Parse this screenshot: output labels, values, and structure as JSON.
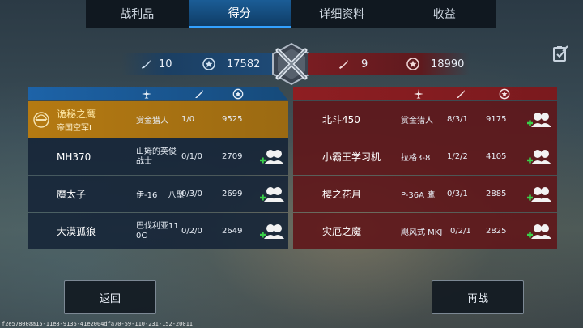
{
  "tabs": [
    {
      "label": "战利品"
    },
    {
      "label": "得分",
      "active": true
    },
    {
      "label": "详细资料"
    },
    {
      "label": "收益"
    }
  ],
  "team_left": {
    "kills": "10",
    "score": "17582"
  },
  "team_right": {
    "kills": "9",
    "score": "18990"
  },
  "columns": {
    "ship": "plane-icon",
    "kda": "sword-icon",
    "score": "star-badge-icon"
  },
  "left_players": [
    {
      "name": "诡秘之鹰",
      "subtitle": "帝国空军L",
      "ship": "赏金猎人",
      "kda": "1/0",
      "score": "9525",
      "badge": "rank-badge-icon"
    },
    {
      "name": "MH370",
      "ship_l1": "山姆的英俊",
      "ship_l2": "战士",
      "kda": "0/1/0",
      "score": "2709"
    },
    {
      "name": "魔太子",
      "ship": "伊-16 十八型",
      "kda": "0/3/0",
      "score": "2699"
    },
    {
      "name": "大漠孤狼",
      "ship_l1": "巴伐利亚11",
      "ship_l2": "0C",
      "kda": "0/2/0",
      "score": "2649"
    }
  ],
  "right_players": [
    {
      "name": "北斗450",
      "ship": "赏金猎人",
      "kda": "8/3/1",
      "score": "9175"
    },
    {
      "name": "小霸王学习机",
      "ship": "拉格3-8",
      "kda": "1/2/2",
      "score": "4105"
    },
    {
      "name": "樱之花月",
      "ship": "P-36A 鹰",
      "kda": "0/3/1",
      "score": "2885"
    },
    {
      "name": "灾厄之魔",
      "ship": "飓风式 MKJ",
      "kda": "0/2/1",
      "score": "2825"
    }
  ],
  "buttons": {
    "back": "返回",
    "rematch": "再战"
  },
  "footer_id": "f2e57800aa15-11e8-9136-41e2004dfa70-59-110-231-152-20011",
  "colors": {
    "blue_team": "#1e4a76",
    "red_team": "#7a1d22",
    "highlight": "#b57a12",
    "active_tab": "#1b5d96"
  }
}
